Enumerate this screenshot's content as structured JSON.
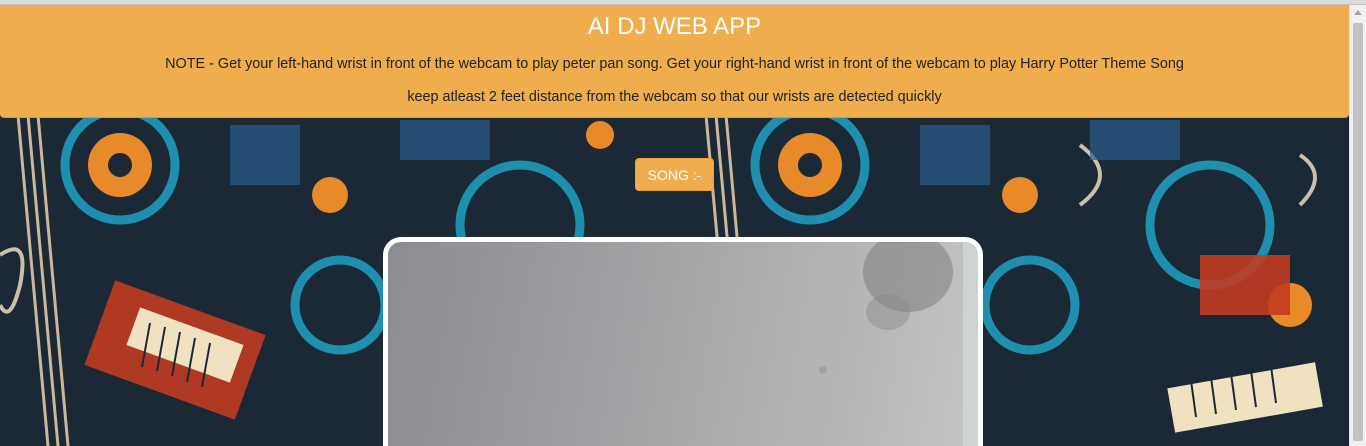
{
  "header": {
    "title": "AI DJ WEB APP",
    "note": "NOTE - Get your left-hand wrist in front of the webcam to play peter pan song. Get your right-hand wrist in front of the webcam to play Harry Potter Theme Song",
    "note2": "keep atleast 2 feet distance from the webcam so that our wrists are detected quickly"
  },
  "song_button": {
    "label": "SONG :-"
  },
  "colors": {
    "accent": "#f0ad4e",
    "header_text": "#ffffff",
    "webcam_border": "#ffffff"
  },
  "icons": {
    "scroll_up": "caret-up-icon"
  }
}
